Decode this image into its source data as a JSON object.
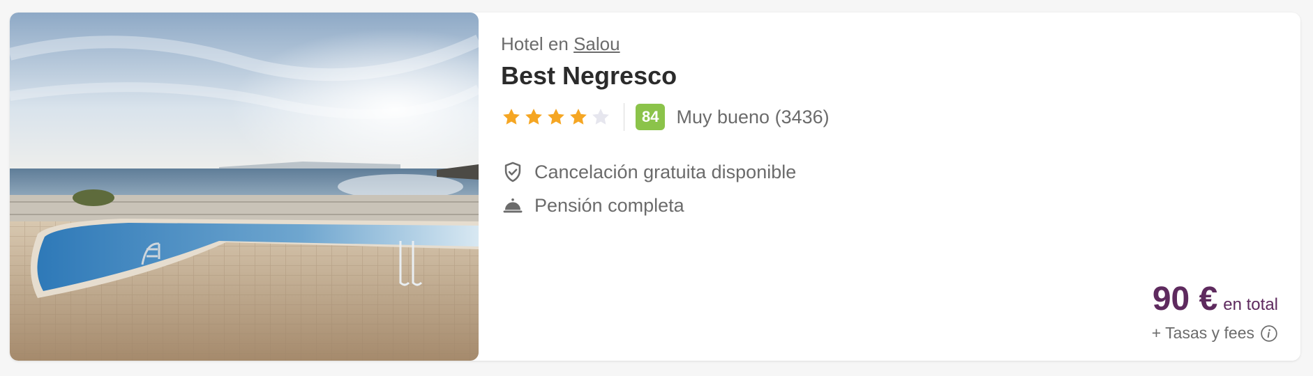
{
  "hotel": {
    "type_label": "Hotel en",
    "location_link": "Salou",
    "name": "Best Negresco",
    "stars_filled": 4,
    "stars_total": 5,
    "score": "84",
    "score_text": "Muy bueno (3436)"
  },
  "features": [
    {
      "icon": "shield-check-icon",
      "label": "Cancelación gratuita disponible"
    },
    {
      "icon": "cloche-icon",
      "label": "Pensión completa"
    }
  ],
  "price": {
    "amount": "90 €",
    "suffix": "en total",
    "taxes": "+ Tasas y fees"
  },
  "colors": {
    "star": "#f5a623",
    "star_empty": "#e6e6ee",
    "score_badge": "#8bc34a",
    "price": "#5e2a5e"
  }
}
